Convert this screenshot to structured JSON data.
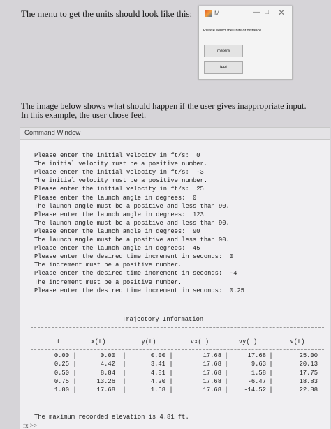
{
  "intro_text": "The menu to get the units should look like this:",
  "menu": {
    "title": "M..",
    "min_glyph": "—",
    "max_glyph": "□",
    "close_glyph": "✕",
    "prompt": "Please select the units of distance",
    "options": [
      "meters",
      "feet"
    ]
  },
  "paragraph": "The image below shows what should happen if the user gives inappropriate input. In this example, the user chose feet.",
  "command_window": {
    "header": "Command Window",
    "lines": [
      "Please enter the initial velocity in ft/s:  0",
      "The initial velocity must be a positive number.",
      "Please enter the initial velocity in ft/s:  -3",
      "The initial velocity must be a positive number.",
      "Please enter the initial velocity in ft/s:  25",
      "Please enter the launch angle in degrees:  0",
      "The launch angle must be a positive and less than 90.",
      "Please enter the launch angle in degrees:  123",
      "The launch angle must be a positive and less than 90.",
      "Please enter the launch angle in degrees:  90",
      "The launch angle must be a positive and less than 90.",
      "Please enter the launch angle in degrees:  45",
      "Please enter the desired time increment in seconds:  0",
      "The increment must be a positive number.",
      "Please enter the desired time increment in seconds:  -4",
      "The increment must be a positive number.",
      "Please enter the desired time increment in seconds:  0.25"
    ],
    "table_title": "Trajectory Information",
    "columns": [
      "t",
      "x(t)",
      "y(t)",
      "vx(t)",
      "vy(t)",
      "v(t)"
    ],
    "separator": "|",
    "rows": [
      [
        "0.00",
        "0.00",
        "0.00",
        "17.68",
        "17.68",
        "25.00"
      ],
      [
        "0.25",
        "4.42",
        "3.41",
        "17.68",
        "9.63",
        "20.13"
      ],
      [
        "0.50",
        "8.84",
        "4.81",
        "17.68",
        "1.58",
        "17.75"
      ],
      [
        "0.75",
        "13.26",
        "4.20",
        "17.68",
        "-6.47",
        "18.83"
      ],
      [
        "1.00",
        "17.68",
        "1.58",
        "17.68",
        "-14.52",
        "22.88"
      ]
    ],
    "footer": "The maximum recorded elevation is 4.81 ft.",
    "prompt_symbol": "fx >>"
  }
}
